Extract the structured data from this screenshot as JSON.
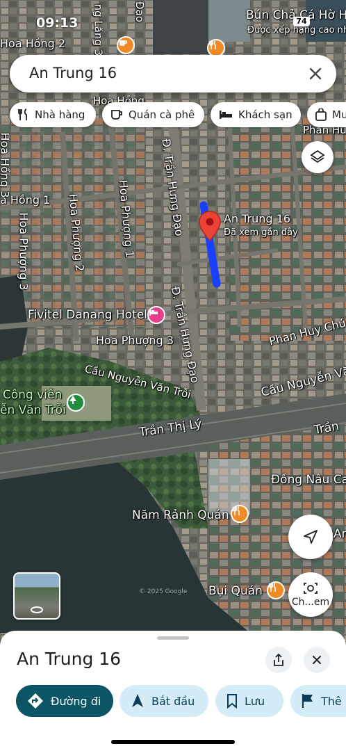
{
  "status_bar": {
    "time": "09:13",
    "battery": "74"
  },
  "search": {
    "query": "An Trung 16"
  },
  "categories": [
    {
      "label": "Nhà hàng",
      "icon": "fork-knife-icon"
    },
    {
      "label": "Quán cà phê",
      "icon": "coffee-cup-icon"
    },
    {
      "label": "Khách sạn",
      "icon": "bed-icon"
    },
    {
      "label": "Mu",
      "icon": "shopping-bag-icon"
    }
  ],
  "map": {
    "selected_pin": {
      "title": "An Trung 16",
      "subtitle": "Đã xem gần đây"
    },
    "labels": {
      "bun_cha": "Bún Chả Cá Hờ Hà",
      "bun_cha_sub": "Được xếp hạng cao nhất",
      "hoa_hong_2": "Hoa Hồng 2",
      "hoa_hong_top": "Hoa Hồng",
      "hoa_hong_1": "a Hồng 1",
      "hoa_hong_3": "Hoa Hồng 3",
      "hoa_phuong_3_left": "Hoa Phượng 3",
      "hoa_phuong_2": "Hoa Phượng 2",
      "hoa_phuong_1": "Hoa Phượng 1",
      "hoa_phuong_3": "Hoa Phượng 3",
      "tran_hung_dao_1": "Đ. Trần Hưng Đạo",
      "tran_hung_dao_2": "Đ. Trần Hưng Đạo",
      "hung_dao_top": "Đạo",
      "bang_lang": "ng Lăng 3",
      "phan_hu_top": "Phan Hu",
      "phan_huy_chu": "Phan Huy Chú",
      "fivitel": "Fivitel Danang Hotel",
      "cau_nvt_1": "Cầu Nguyễn Văn Trỗi",
      "cau_nvt_2": "Cầu Nguyễn Văn",
      "cong_vien_1": "Công viên",
      "cong_vien_2": "ễn Văn Trỗi",
      "tran_thi_ly": "Trần Thị Lý",
      "tran_right": "Trần",
      "dong_nau": "Đồng Nâu Ca",
      "nam_ranh": "Năm Rảnh Quán",
      "bui_quan": "Bụi Quán",
      "an_right": "An",
      "watermark": "© 2025 Google"
    }
  },
  "controls": {
    "camera_label": "Ch...em"
  },
  "sheet": {
    "title": "An Trung 16",
    "actions": [
      {
        "label": "Đường đi",
        "icon": "directions-icon"
      },
      {
        "label": "Bắt đầu",
        "icon": "navigation-arrow-icon"
      },
      {
        "label": "Lưu",
        "icon": "bookmark-icon"
      },
      {
        "label": "Thê",
        "icon": "flag-icon"
      }
    ]
  },
  "colors": {
    "accent": "#0b5566",
    "chip_tint": "#d3ecf7",
    "route": "#1a40ff",
    "pin": "#ea4335"
  }
}
